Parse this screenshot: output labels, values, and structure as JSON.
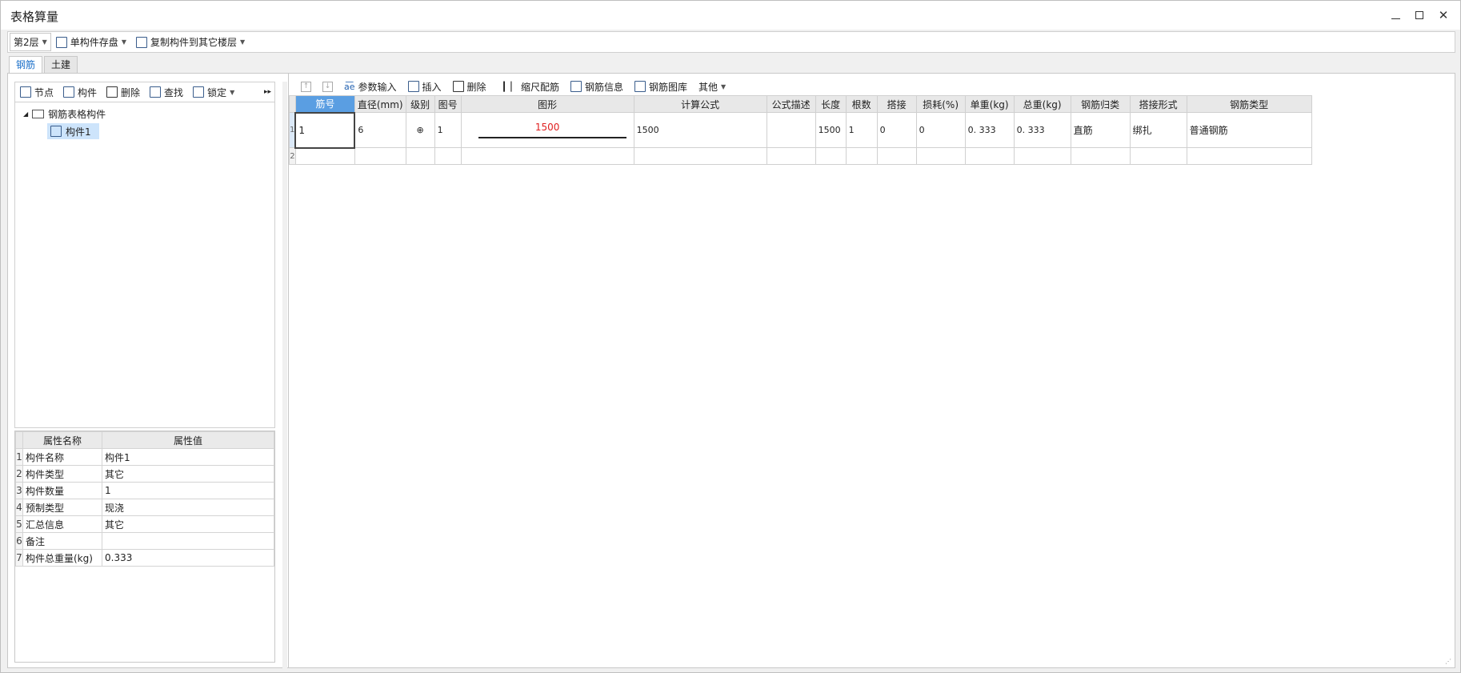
{
  "window": {
    "title": "表格算量"
  },
  "toolbar": {
    "floor": "第2层",
    "save_label": "单构件存盘",
    "copy_label": "复制构件到其它楼层"
  },
  "tabs": [
    {
      "label": "钢筋",
      "active": true
    },
    {
      "label": "土建",
      "active": false
    }
  ],
  "left_toolbar": {
    "node": "节点",
    "component": "构件",
    "delete": "删除",
    "find": "查找",
    "lock": "锁定"
  },
  "tree": {
    "root": "钢筋表格构件",
    "child": "构件1"
  },
  "props": {
    "header_name": "属性名称",
    "header_value": "属性值",
    "rows": [
      {
        "num": "1",
        "name": "构件名称",
        "value": "构件1"
      },
      {
        "num": "2",
        "name": "构件类型",
        "value": "其它"
      },
      {
        "num": "3",
        "name": "构件数量",
        "value": "1"
      },
      {
        "num": "4",
        "name": "预制类型",
        "value": "现浇"
      },
      {
        "num": "5",
        "name": "汇总信息",
        "value": "其它"
      },
      {
        "num": "6",
        "name": "备注",
        "value": ""
      },
      {
        "num": "7",
        "name": "构件总重量(kg)",
        "value": "0.333"
      }
    ]
  },
  "right_toolbar": {
    "param_input": "参数输入",
    "insert": "插入",
    "delete": "删除",
    "scale": "缩尺配筋",
    "rebar_info": "钢筋信息",
    "rebar_lib": "钢筋图库",
    "other": "其他"
  },
  "grid": {
    "headers": [
      "筋号",
      "直径(mm)",
      "级别",
      "图号",
      "图形",
      "计算公式",
      "公式描述",
      "长度",
      "根数",
      "搭接",
      "损耗(%)",
      "单重(kg)",
      "总重(kg)",
      "钢筋归类",
      "搭接形式",
      "钢筋类型"
    ],
    "row1": {
      "num": "1",
      "bar_no": "1",
      "diameter": "6",
      "grade": "⊕",
      "fig_no": "1",
      "shape_value": "1500",
      "formula": "1500",
      "desc": "",
      "length": "1500",
      "count": "1",
      "lap": "0",
      "loss": "0",
      "unit_weight": "0. 333",
      "total_weight": "0. 333",
      "category": "直筋",
      "lap_type": "绑扎",
      "rebar_type": "普通钢筋"
    },
    "row2_num": "2"
  }
}
